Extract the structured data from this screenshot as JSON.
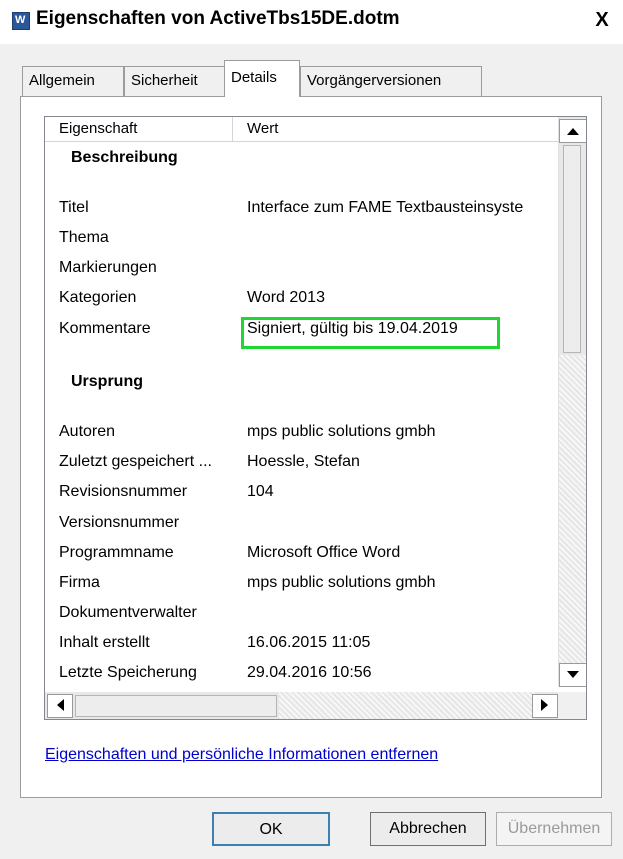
{
  "window": {
    "title": "Eigenschaften von ActiveTbs15DE.dotm",
    "close_label": "X",
    "icon": "word-document-icon",
    "icon_glyph": "W"
  },
  "tabs": [
    {
      "label": "Allgemein"
    },
    {
      "label": "Sicherheit"
    },
    {
      "label": "Details",
      "active": true
    },
    {
      "label": "Vorgängerversionen"
    }
  ],
  "listview": {
    "headers": {
      "property": "Eigenschaft",
      "value": "Wert"
    },
    "groups": {
      "description": "Beschreibung",
      "origin": "Ursprung"
    },
    "rows": [
      {
        "k": "Titel",
        "v": "Interface zum FAME Textbausteinsyste"
      },
      {
        "k": "Thema",
        "v": ""
      },
      {
        "k": "Markierungen",
        "v": ""
      },
      {
        "k": "Kategorien",
        "v": "Word 2013"
      },
      {
        "k": "Kommentare",
        "v": "Signiert, gültig bis 19.04.2019"
      },
      {
        "k": "Autoren",
        "v": "mps public solutions gmbh"
      },
      {
        "k": "Zuletzt gespeichert ...",
        "v": "Hoessle, Stefan"
      },
      {
        "k": "Revisionsnummer",
        "v": "104"
      },
      {
        "k": "Versionsnummer",
        "v": ""
      },
      {
        "k": "Programmname",
        "v": "Microsoft Office Word"
      },
      {
        "k": "Firma",
        "v": "mps public solutions gmbh"
      },
      {
        "k": "Dokumentverwalter",
        "v": ""
      },
      {
        "k": "Inhalt erstellt",
        "v": "16.06.2015 11:05"
      },
      {
        "k": "Letzte Speicherung",
        "v": "29.04.2016 10:56"
      }
    ],
    "highlight_color": "#1fd633"
  },
  "link": {
    "label": "Eigenschaften und persönliche Informationen entfernen"
  },
  "buttons": {
    "ok": "OK",
    "cancel": "Abbrechen",
    "apply": "Übernehmen"
  }
}
